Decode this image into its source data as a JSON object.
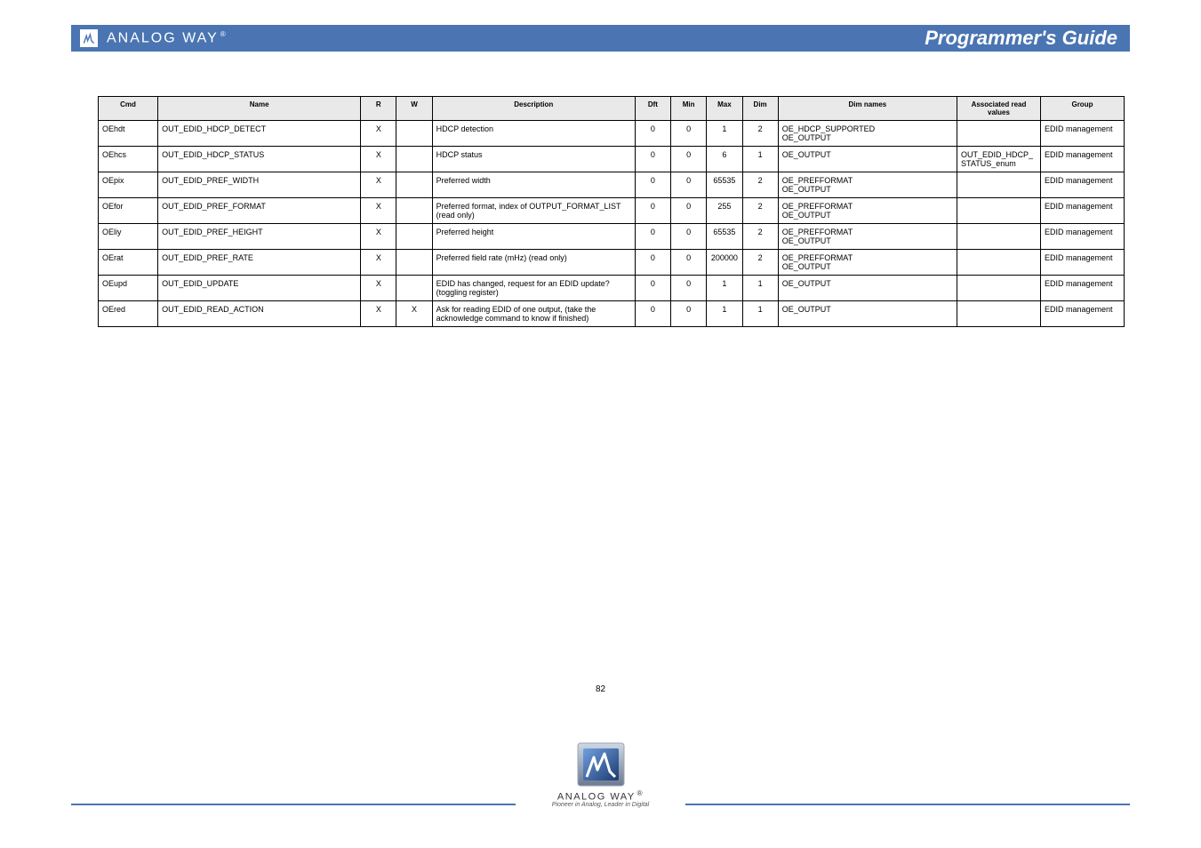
{
  "header": {
    "brand": "ANALOG WAY",
    "trademark": "®",
    "title": "Programmer's Guide"
  },
  "table": {
    "headers": [
      "Cmd",
      "Name",
      "R",
      "W",
      "Description",
      "Dft",
      "Min",
      "Max",
      "Dim",
      "Dim names",
      "Associated read values",
      "Group"
    ],
    "rows": [
      {
        "cmd": "OEhdt",
        "name": "OUT_EDID_HDCP_DETECT",
        "r": "X",
        "w": "",
        "desc": "HDCP detection",
        "dft": "0",
        "min": "0",
        "max": "1",
        "dim": "2",
        "dims": "OE_HDCP_SUPPORTED\nOE_OUTPUT",
        "assoc": "",
        "group": "EDID management"
      },
      {
        "cmd": "OEhcs",
        "name": "OUT_EDID_HDCP_STATUS",
        "r": "X",
        "w": "",
        "desc": "HDCP status",
        "dft": "0",
        "min": "0",
        "max": "6",
        "dim": "1",
        "dims": "OE_OUTPUT",
        "assoc": "OUT_EDID_HDCP_STATUS_enum",
        "group": "EDID management"
      },
      {
        "cmd": "OEpix",
        "name": "OUT_EDID_PREF_WIDTH",
        "r": "X",
        "w": "",
        "desc": "Preferred width",
        "dft": "0",
        "min": "0",
        "max": "65535",
        "dim": "2",
        "dims": "OE_PREFFORMAT\nOE_OUTPUT",
        "assoc": "",
        "group": "EDID management"
      },
      {
        "cmd": "OEfor",
        "name": "OUT_EDID_PREF_FORMAT",
        "r": "X",
        "w": "",
        "desc": "Preferred format, index of OUTPUT_FORMAT_LIST (read only)",
        "dft": "0",
        "min": "0",
        "max": "255",
        "dim": "2",
        "dims": "OE_PREFFORMAT\nOE_OUTPUT",
        "assoc": "",
        "group": "EDID management"
      },
      {
        "cmd": "OEliy",
        "name": "OUT_EDID_PREF_HEIGHT",
        "r": "X",
        "w": "",
        "desc": "Preferred height",
        "dft": "0",
        "min": "0",
        "max": "65535",
        "dim": "2",
        "dims": "OE_PREFFORMAT\nOE_OUTPUT",
        "assoc": "",
        "group": "EDID management"
      },
      {
        "cmd": "OErat",
        "name": "OUT_EDID_PREF_RATE",
        "r": "X",
        "w": "",
        "desc": "Preferred field rate (mHz) (read only)",
        "dft": "0",
        "min": "0",
        "max": "200000",
        "dim": "2",
        "dims": "OE_PREFFORMAT\nOE_OUTPUT",
        "assoc": "",
        "group": "EDID management"
      },
      {
        "cmd": "OEupd",
        "name": "OUT_EDID_UPDATE",
        "r": "X",
        "w": "",
        "desc": "EDID has changed, request for an EDID update? (toggling register)",
        "dft": "0",
        "min": "0",
        "max": "1",
        "dim": "1",
        "dims": "OE_OUTPUT",
        "assoc": "",
        "group": "EDID management"
      },
      {
        "cmd": "OEred",
        "name": "OUT_EDID_READ_ACTION",
        "r": "X",
        "w": "X",
        "desc": "Ask for reading EDID of one output, (take the acknowledge command to know if finished)",
        "dft": "0",
        "min": "0",
        "max": "1",
        "dim": "1",
        "dims": "OE_OUTPUT",
        "assoc": "",
        "group": "EDID management"
      }
    ]
  },
  "page_number": "82",
  "footer": {
    "brand": "ANALOG WAY",
    "trademark": "®",
    "tagline": "Pioneer in Analog, Leader in Digital"
  }
}
